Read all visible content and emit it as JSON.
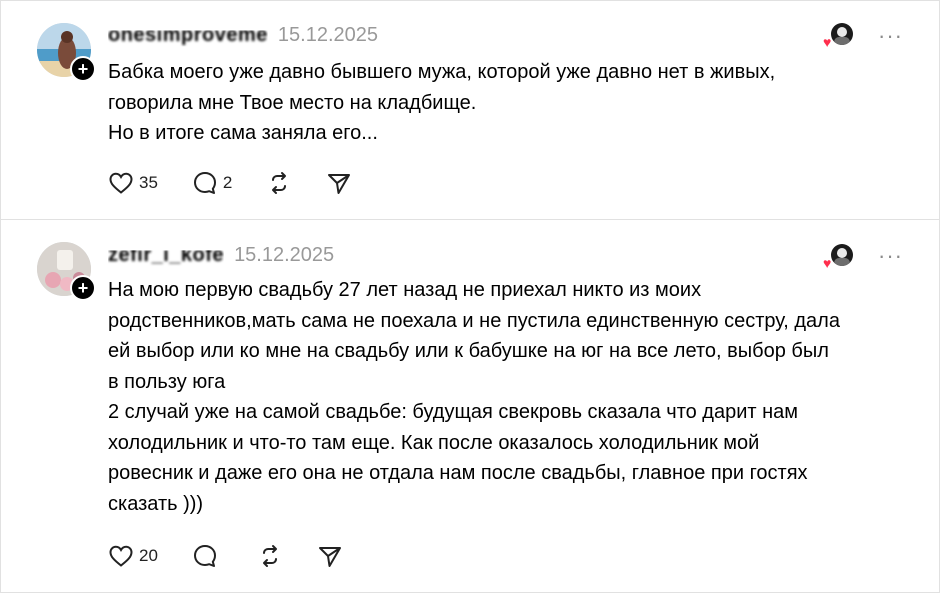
{
  "posts": [
    {
      "username": "onesimproveme",
      "date": "15.12.2025",
      "text": "Бабка моего уже давно бывшего мужа, которой уже давно нет в живых,\nговорила мне Твое место на кладбище.\nНо в итоге сама заняла его...",
      "likes": "35",
      "replies": "2",
      "reposts": "",
      "avatar_icon": "beach-photo-avatar",
      "plus_symbol": "+",
      "more_symbol": "···",
      "reactor_icon": "heart-reaction-icon"
    },
    {
      "username": "zefir_i_kofe",
      "date": "15.12.2025",
      "text": "На мою первую свадьбу 27 лет назад не приехал никто из моих\nродственников,мать сама не поехала и не пустила единственную сестру, дала\nей выбор или ко мне на свадьбу или к бабушке на юг на все лето, выбор был\nв пользу юга\n2 случай уже на самой свадьбе: будущая свекровь сказала что дарит нам\nхолодильник и что-то там еще. Как после оказалось холодильник мой\nровесник и даже его она не отдала нам после свадьбы, главное при гостях\nсказать )))",
      "likes": "20",
      "replies": "",
      "reposts": "",
      "avatar_icon": "cup-photo-avatar",
      "plus_symbol": "+",
      "more_symbol": "···",
      "reactor_icon": "heart-reaction-icon"
    }
  ],
  "colors": {
    "text": "#000000",
    "muted": "#999999",
    "divider": "#e1e1e1",
    "heart": "#ff2e4d"
  }
}
